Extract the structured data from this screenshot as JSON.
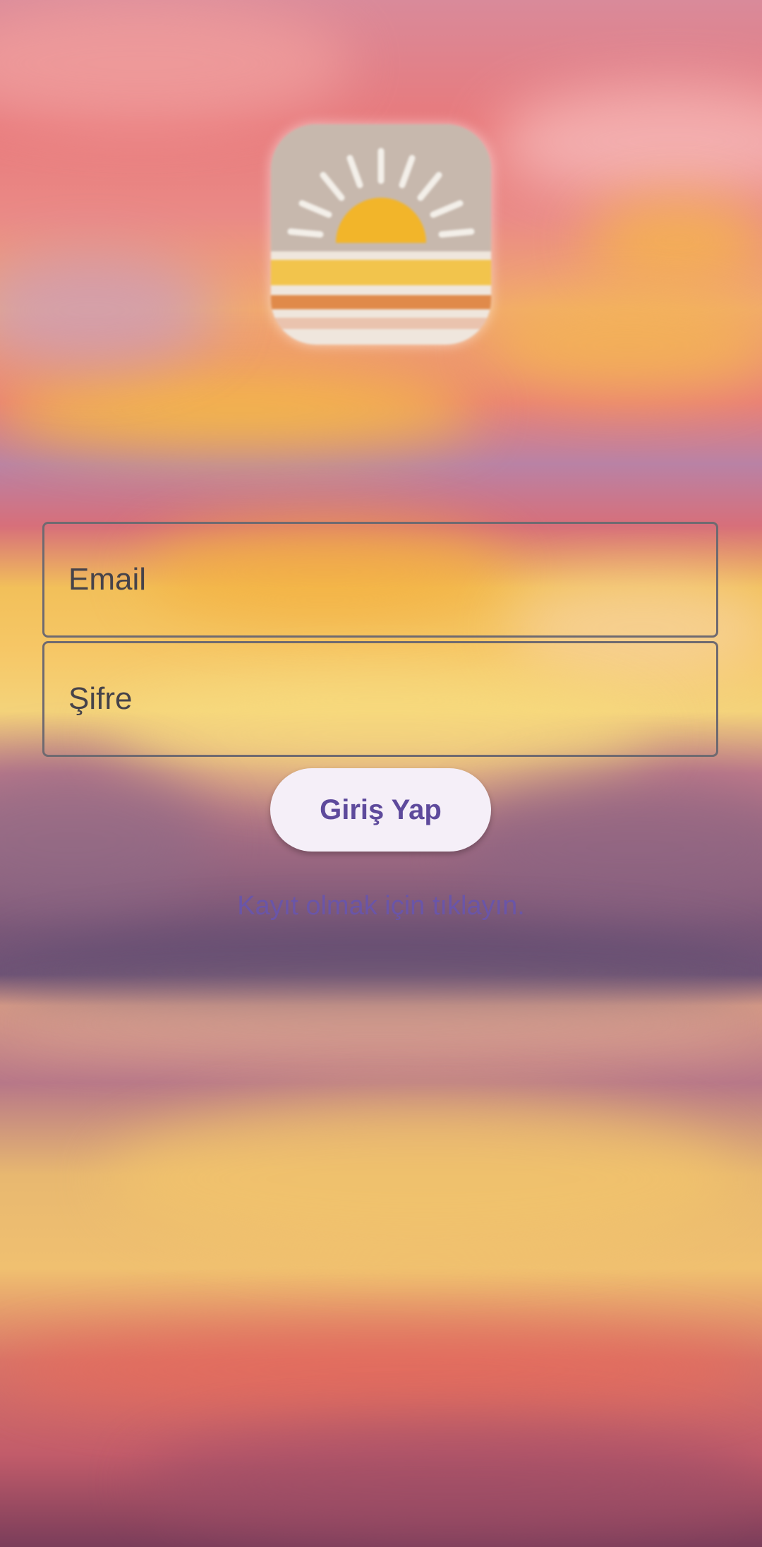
{
  "login_form": {
    "email_placeholder": "Email",
    "password_placeholder": "Şifre",
    "login_button_label": "Giriş Yap",
    "register_link_text": "Kayıt olmak için tıklayın."
  },
  "icons": {
    "app_logo": "sunset-logo-icon"
  },
  "colors": {
    "button_bg": "#f5eff8",
    "button_text": "#5e4a9c",
    "link_text": "#6a55a8",
    "field_border": "#6f6a70"
  }
}
